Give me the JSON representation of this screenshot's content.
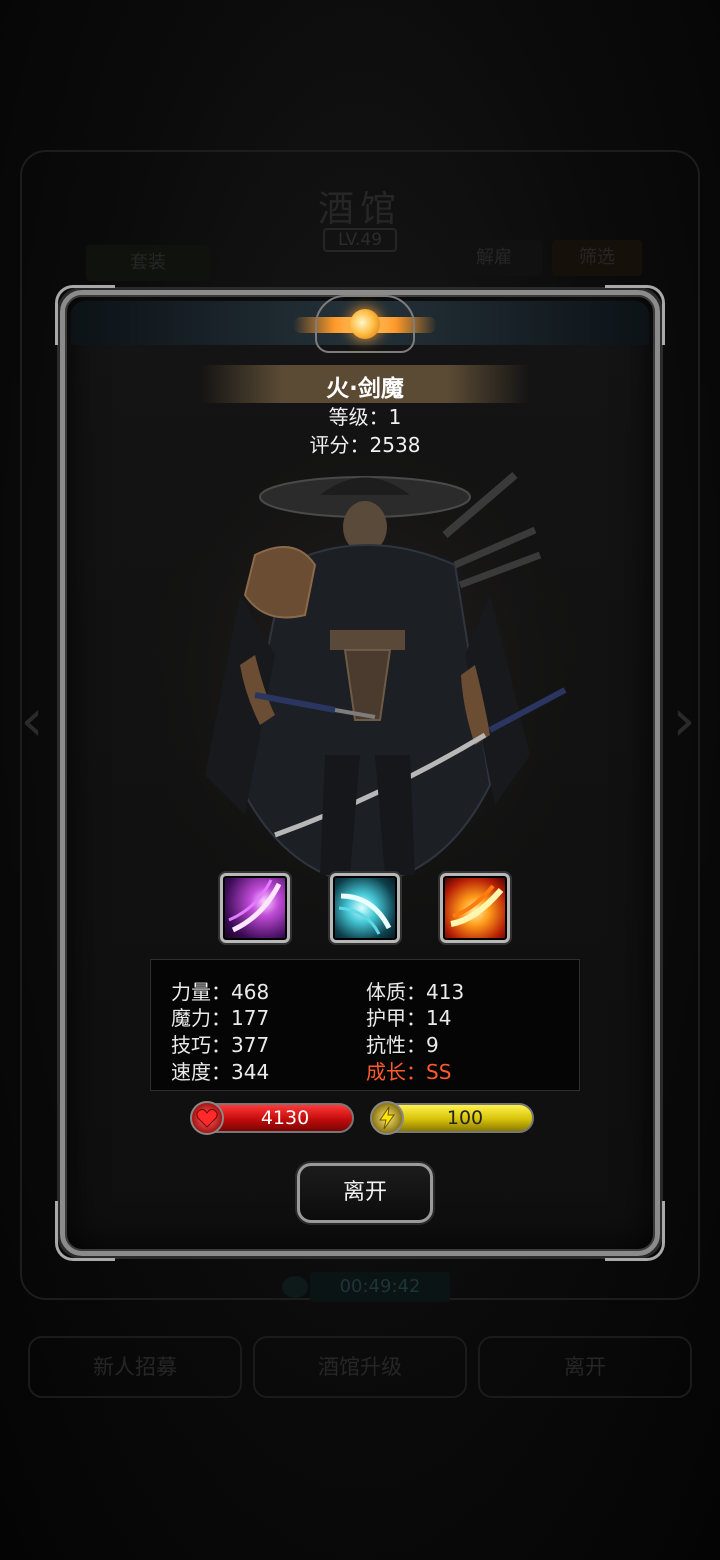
{
  "background": {
    "title": "酒馆",
    "level": "LV.49",
    "tabs": [
      "套装",
      "解雇",
      "筛选"
    ],
    "timer": "00:49:42",
    "buttons": [
      "新人招募",
      "酒馆升级",
      "离开"
    ]
  },
  "hero": {
    "name": "火·剑魔",
    "level_line": "等级：1",
    "score_line": "评分：2538"
  },
  "skills": [
    {
      "icon": "purple-slash-skill-icon"
    },
    {
      "icon": "cyan-wind-slash-skill-icon"
    },
    {
      "icon": "fire-slash-skill-icon"
    }
  ],
  "stats": {
    "strength": "力量：468",
    "constitution": "体质：413",
    "magic": "魔力：177",
    "armor": "护甲：14",
    "skill": "技巧：377",
    "resistance": "抗性：9",
    "speed": "速度：344",
    "growth": "成长：SS"
  },
  "bars": {
    "hp": "4130",
    "energy": "100"
  },
  "leave_button": "离开",
  "colors": {
    "growth": "#ff5a2a",
    "hp_bar": "#d01010",
    "energy_bar": "#e0cc10",
    "frame": "#8b8b8b"
  }
}
